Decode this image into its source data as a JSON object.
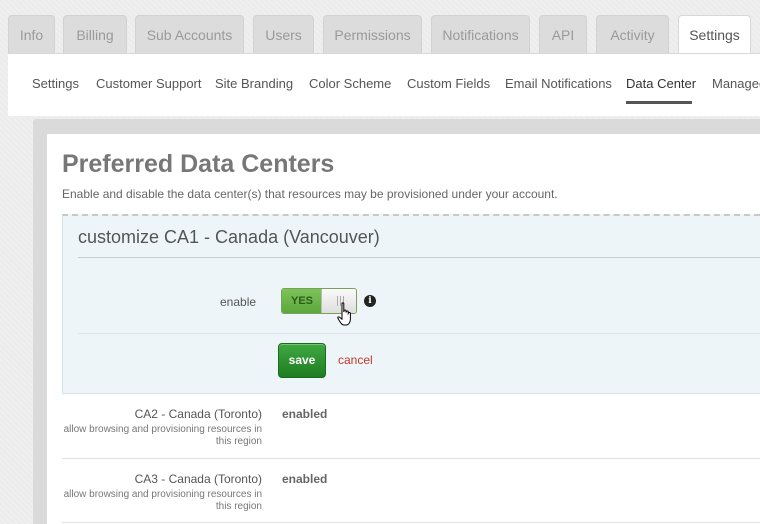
{
  "top_tabs": [
    {
      "label": "Info"
    },
    {
      "label": "Billing"
    },
    {
      "label": "Sub Accounts"
    },
    {
      "label": "Users"
    },
    {
      "label": "Permissions"
    },
    {
      "label": "Notifications"
    },
    {
      "label": "API"
    },
    {
      "label": "Activity"
    },
    {
      "label": "Settings",
      "active": true
    }
  ],
  "sub_nav": [
    {
      "label": "Settings"
    },
    {
      "label": "Customer Support"
    },
    {
      "label": "Site Branding"
    },
    {
      "label": "Color Scheme"
    },
    {
      "label": "Custom Fields"
    },
    {
      "label": "Email Notifications"
    },
    {
      "label": "Data Center",
      "active": true
    },
    {
      "label": "Managed"
    }
  ],
  "page": {
    "title": "Preferred Data Centers",
    "description": "Enable and disable the data center(s) that resources may be provisioned under your account."
  },
  "edit": {
    "title": "customize CA1 - Canada (Vancouver)",
    "enable_label": "enable",
    "toggle_value": "YES",
    "info_glyph": "i",
    "save_label": "save",
    "cancel_label": "cancel"
  },
  "regions": [
    {
      "name": "CA2 - Canada (Toronto)",
      "desc": "allow browsing and provisioning resources in this region",
      "status": "enabled"
    },
    {
      "name": "CA3 - Canada (Toronto)",
      "desc": "allow browsing and provisioning resources in this region",
      "status": "enabled"
    }
  ],
  "colors": {
    "toggle_on": "#6cb84b",
    "save_button": "#2e9432",
    "cancel_link": "#c0392b"
  }
}
